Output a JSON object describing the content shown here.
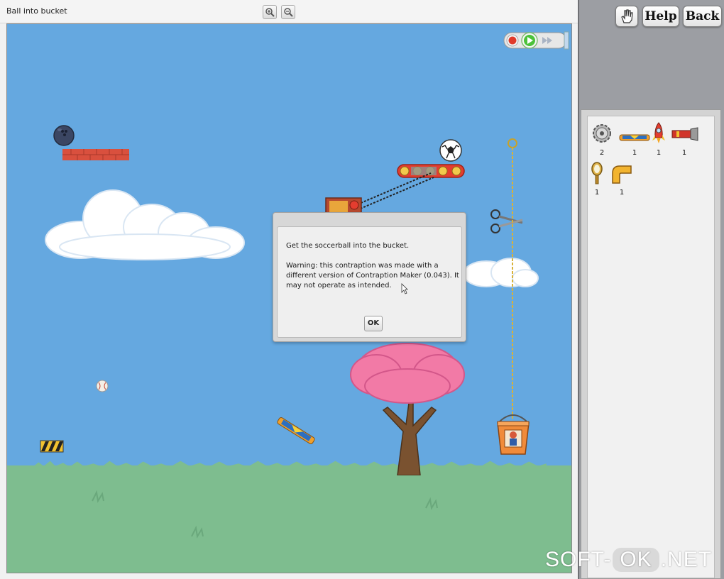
{
  "window": {
    "title": "Ball into bucket",
    "zoom_in_icon": "zoom-in-icon",
    "zoom_out_icon": "zoom-out-icon"
  },
  "header_buttons": {
    "hand_icon": "hand-icon",
    "help_label": "Help",
    "back_label": "Back"
  },
  "playback": {
    "record_icon": "record-icon",
    "play_icon": "play-icon",
    "fast_forward_icon": "fast-forward-icon",
    "colors": {
      "record": "#e03a2a",
      "play": "#4cc23a"
    }
  },
  "parts": [
    {
      "name": "gear",
      "icon": "gear-icon",
      "count": "2"
    },
    {
      "name": "trampoline",
      "icon": "trampoline-icon",
      "count": "1"
    },
    {
      "name": "rocket",
      "icon": "rocket-icon",
      "count": "1"
    },
    {
      "name": "flashlight",
      "icon": "flashlight-icon",
      "count": "1"
    },
    {
      "name": "mirror",
      "icon": "mirror-icon",
      "count": "1"
    },
    {
      "name": "pipe",
      "icon": "pipe-elbow-icon",
      "count": "1"
    }
  ],
  "dialog": {
    "message": "Get the soccerball into the bucket.",
    "warning": "Warning: this contraption was made with a different version of Contraption Maker (0.043). It may not operate as intended.",
    "ok_label": "OK"
  },
  "watermark": {
    "left": "SOFT-",
    "middle": "OK",
    "right": ".NET"
  },
  "colors": {
    "sky": "#65a8e0",
    "ground": "#7ebd8f",
    "tree_blossom": "#f27aa6",
    "tree_trunk": "#7a5230"
  }
}
